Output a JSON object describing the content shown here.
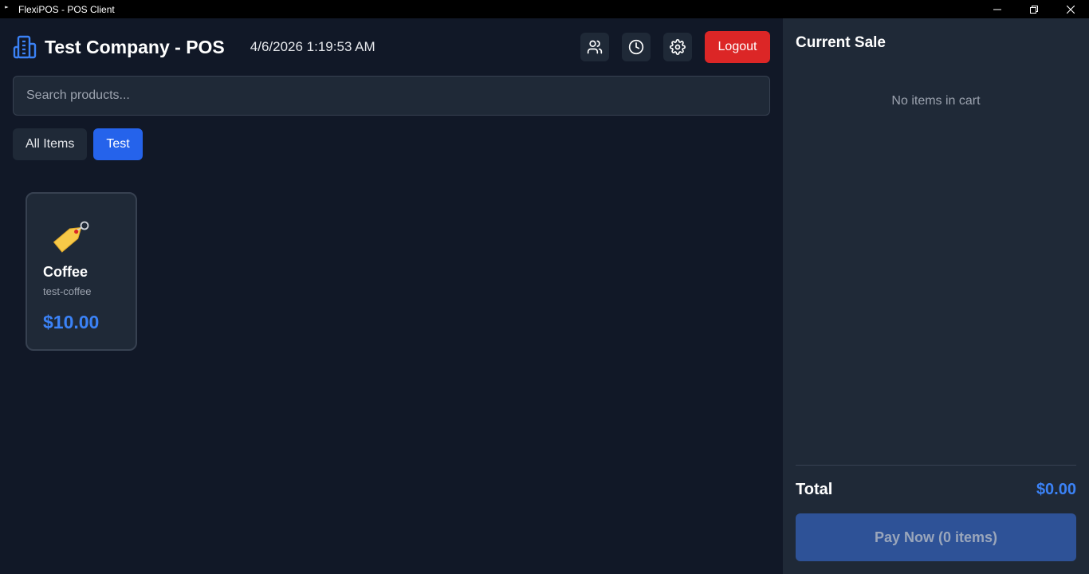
{
  "window": {
    "title": "FlexiPOS - POS Client",
    "icon": "app-icon",
    "controls": [
      "minimize-icon",
      "restore-icon",
      "close-icon"
    ]
  },
  "header": {
    "icon": "building-icon",
    "company_title": "Test Company - POS",
    "datetime": "4/6/2026 1:19:53 AM",
    "actions": {
      "customers_icon": "users-icon",
      "history_icon": "clock-icon",
      "settings_icon": "gear-icon",
      "logout_label": "Logout"
    }
  },
  "search": {
    "placeholder": "Search products...",
    "value": ""
  },
  "categories": [
    {
      "label": "All Items",
      "active": false
    },
    {
      "label": "Test",
      "active": true
    }
  ],
  "products": [
    {
      "icon": "price-tag-icon",
      "name": "Coffee",
      "sku": "test-coffee",
      "price": "$10.00"
    }
  ],
  "cart": {
    "title": "Current Sale",
    "empty_message": "No items in cart",
    "total_label": "Total",
    "total_value": "$0.00",
    "pay_button_label": "Pay Now (0 items)"
  },
  "colors": {
    "background": "#111827",
    "panel": "#1f2937",
    "accent": "#2563eb",
    "price": "#3b82f6",
    "danger": "#dc2626"
  }
}
